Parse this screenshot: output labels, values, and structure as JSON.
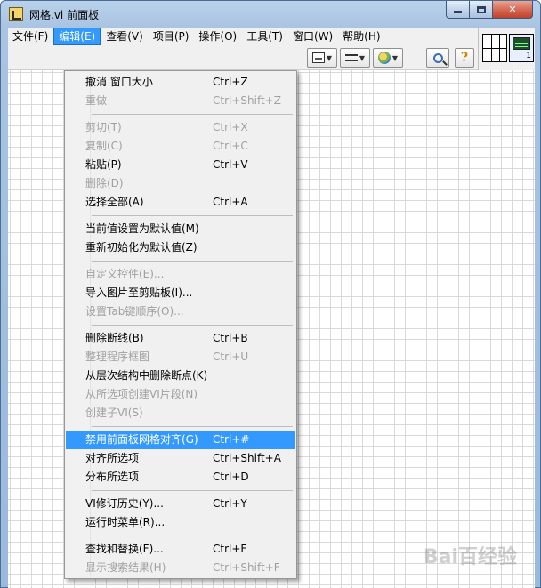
{
  "window": {
    "title": "网格.vi 前面板"
  },
  "menubar": {
    "items": [
      {
        "label": "文件(F)",
        "active": false
      },
      {
        "label": "编辑(E)",
        "active": true
      },
      {
        "label": "查看(V)",
        "active": false
      },
      {
        "label": "项目(P)",
        "active": false
      },
      {
        "label": "操作(O)",
        "active": false
      },
      {
        "label": "工具(T)",
        "active": false
      },
      {
        "label": "窗口(W)",
        "active": false
      },
      {
        "label": "帮助(H)",
        "active": false
      }
    ]
  },
  "toolbar": {
    "buttons": [
      {
        "name": "align-objects-icon"
      },
      {
        "name": "distribute-objects-icon"
      },
      {
        "name": "reorder-icon"
      },
      {
        "name": "search-icon"
      },
      {
        "name": "help-icon"
      }
    ],
    "help_glyph": "?"
  },
  "vi_icon": {
    "number": "1"
  },
  "edit_menu": {
    "groups": [
      [
        {
          "label": "撤消 窗口大小",
          "shortcut": "Ctrl+Z",
          "enabled": true
        },
        {
          "label": "重做",
          "shortcut": "Ctrl+Shift+Z",
          "enabled": false
        }
      ],
      [
        {
          "label": "剪切(T)",
          "shortcut": "Ctrl+X",
          "enabled": false
        },
        {
          "label": "复制(C)",
          "shortcut": "Ctrl+C",
          "enabled": false
        },
        {
          "label": "粘贴(P)",
          "shortcut": "Ctrl+V",
          "enabled": true
        },
        {
          "label": "删除(D)",
          "shortcut": "",
          "enabled": false
        },
        {
          "label": "选择全部(A)",
          "shortcut": "Ctrl+A",
          "enabled": true
        }
      ],
      [
        {
          "label": "当前值设置为默认值(M)",
          "shortcut": "",
          "enabled": true
        },
        {
          "label": "重新初始化为默认值(Z)",
          "shortcut": "",
          "enabled": true
        }
      ],
      [
        {
          "label": "自定义控件(E)...",
          "shortcut": "",
          "enabled": false
        },
        {
          "label": "导入图片至剪贴板(I)...",
          "shortcut": "",
          "enabled": true
        },
        {
          "label": "设置Tab键顺序(O)...",
          "shortcut": "",
          "enabled": false
        }
      ],
      [
        {
          "label": "删除断线(B)",
          "shortcut": "Ctrl+B",
          "enabled": true
        },
        {
          "label": "整理程序框图",
          "shortcut": "Ctrl+U",
          "enabled": false
        },
        {
          "label": "从层次结构中删除断点(K)",
          "shortcut": "",
          "enabled": true
        },
        {
          "label": "从所选项创建VI片段(N)",
          "shortcut": "",
          "enabled": false
        },
        {
          "label": "创建子VI(S)",
          "shortcut": "",
          "enabled": false
        }
      ],
      [
        {
          "label": "禁用前面板网格对齐(G)",
          "shortcut": "Ctrl+#",
          "enabled": true,
          "selected": true
        },
        {
          "label": "对齐所选项",
          "shortcut": "Ctrl+Shift+A",
          "enabled": true
        },
        {
          "label": "分布所选项",
          "shortcut": "Ctrl+D",
          "enabled": true
        }
      ],
      [
        {
          "label": "VI修订历史(Y)...",
          "shortcut": "Ctrl+Y",
          "enabled": true
        },
        {
          "label": "运行时菜单(R)...",
          "shortcut": "",
          "enabled": true
        }
      ],
      [
        {
          "label": "查找和替换(F)...",
          "shortcut": "Ctrl+F",
          "enabled": true
        },
        {
          "label": "显示搜索结果(H)",
          "shortcut": "Ctrl+Shift+F",
          "enabled": false
        }
      ]
    ]
  },
  "colors": {
    "highlight": "#3399ff",
    "disabled_text": "#a0a0a0",
    "grid_line": "#d9d9d9"
  },
  "watermark": "Bai百经验"
}
